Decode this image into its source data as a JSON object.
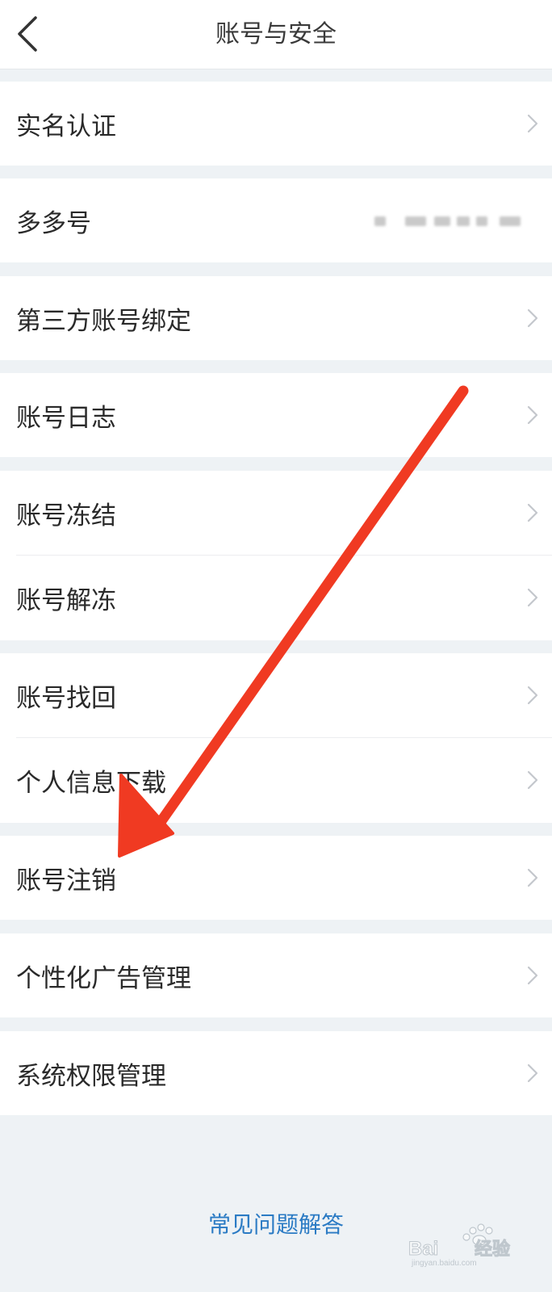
{
  "header": {
    "title": "账号与安全",
    "back_icon": "back-arrow-icon"
  },
  "menu": {
    "items": [
      {
        "label": "实名认证"
      },
      {
        "label": "多多号"
      },
      {
        "label": "第三方账号绑定"
      },
      {
        "label": "账号日志"
      },
      {
        "label": "账号冻结"
      },
      {
        "label": "账号解冻"
      },
      {
        "label": "账号找回"
      },
      {
        "label": "个人信息下载"
      },
      {
        "label": "账号注销"
      },
      {
        "label": "个性化广告管理"
      },
      {
        "label": "系统权限管理"
      }
    ]
  },
  "faq": {
    "label": "常见问题解答"
  },
  "colors": {
    "background": "#eef2f5",
    "row_background": "#ffffff",
    "link": "#2b7bc4",
    "annotation_arrow": "#f03a22"
  },
  "icons": {
    "chevron": "chevron-right-icon",
    "watermark": "baidu-jingyan-logo"
  }
}
